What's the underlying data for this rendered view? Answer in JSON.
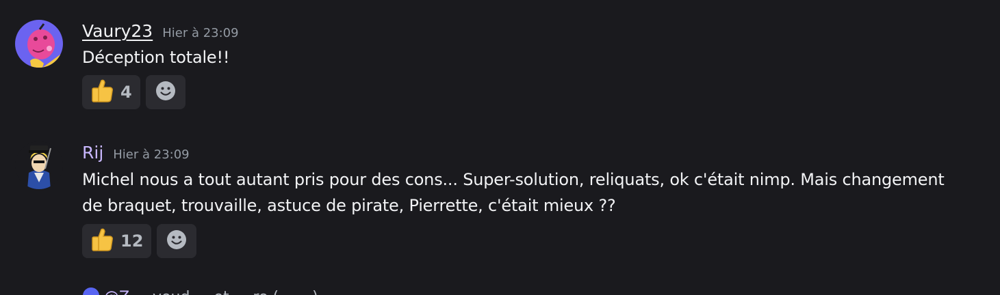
{
  "messages": [
    {
      "username": "Vaury23",
      "timestamp": "Hier à 23:09",
      "content": "Déception totale!!",
      "reactions": [
        {
          "emoji": "thumbs-up",
          "count": "4"
        }
      ]
    },
    {
      "username": "Rij",
      "timestamp": "Hier à 23:09",
      "content": "Michel nous a tout autant pris pour des cons... Super-solution, reliquats, ok c'était nimp. Mais changement de braquet, trouvaille, astuce de pirate, Pierrette, c'était mieux ??",
      "reactions": [
        {
          "emoji": "thumbs-up",
          "count": "12"
        }
      ]
    }
  ],
  "cutoff_reply": {
    "username": "@Z",
    "preview": "... voud ... et ... ro (... ...) ... ... ..."
  },
  "colors": {
    "background": "#1a1a1e",
    "reaction_bg": "#2b2b30",
    "username_rij": "#c9b8ff"
  }
}
